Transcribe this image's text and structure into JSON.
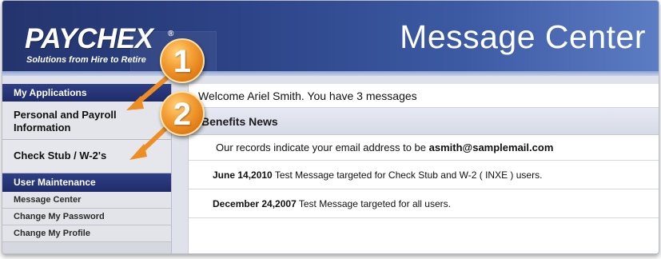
{
  "header": {
    "logo_text": "PAYCHEX",
    "logo_registered": "®",
    "logo_tagline": "Solutions from Hire to Retire",
    "title": "Message Center"
  },
  "sidebar": {
    "my_applications": "My Applications",
    "items": [
      {
        "label": "Personal and Payroll Information"
      },
      {
        "label": "Check Stub / W-2's"
      }
    ],
    "user_maintenance": "User Maintenance",
    "sub_items": [
      {
        "label": "Message Center"
      },
      {
        "label": "Change My Password"
      },
      {
        "label": "Change My Profile"
      }
    ]
  },
  "main": {
    "welcome": "Welcome Ariel Smith. You have 3 messages",
    "news_header": "Benefits News",
    "email_notice_prefix": "Our records indicate your email address to be ",
    "email": "asmith@samplemail.com",
    "messages": [
      {
        "date": "June 14,2010",
        "text": " Test Message targeted for Check Stub and W-2 ( INXE ) users."
      },
      {
        "date": "December 24,2007",
        "text": " Test Message targeted for all users."
      }
    ]
  },
  "callouts": [
    {
      "number": "1"
    },
    {
      "number": "2"
    }
  ],
  "colors": {
    "header_blue": "#2c4386",
    "sidebar_head": "#1f2c6a",
    "callout_orange": "#f6a33b"
  }
}
